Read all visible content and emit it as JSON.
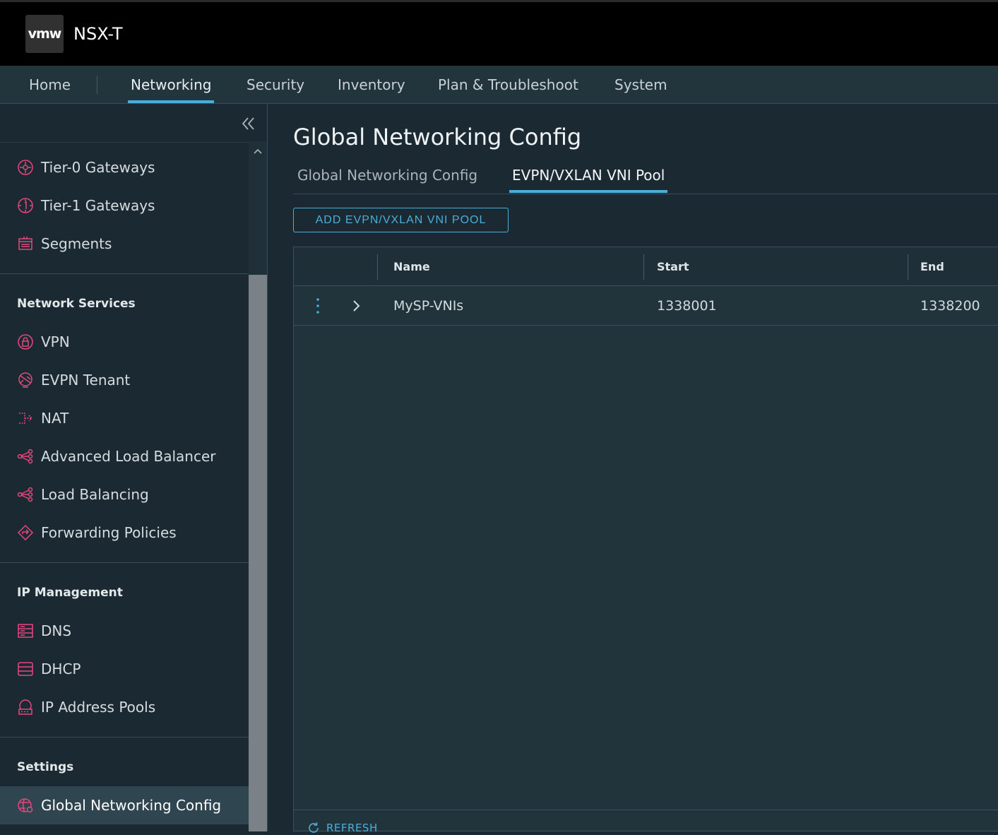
{
  "header": {
    "logo": "vmw",
    "app_title": "NSX-T"
  },
  "nav": {
    "items": [
      {
        "label": "Home"
      },
      {
        "label": "Networking"
      },
      {
        "label": "Security"
      },
      {
        "label": "Inventory"
      },
      {
        "label": "Plan & Troubleshoot"
      },
      {
        "label": "System"
      }
    ],
    "active": "Networking"
  },
  "sidebar": {
    "top_items": [
      {
        "label": "Tier-0 Gateways",
        "icon": "tier0-gateway-icon"
      },
      {
        "label": "Tier-1 Gateways",
        "icon": "tier1-gateway-icon"
      },
      {
        "label": "Segments",
        "icon": "segments-icon"
      }
    ],
    "network_services": {
      "title": "Network Services",
      "items": [
        {
          "label": "VPN",
          "icon": "vpn-icon"
        },
        {
          "label": "EVPN Tenant",
          "icon": "evpn-tenant-icon"
        },
        {
          "label": "NAT",
          "icon": "nat-icon"
        },
        {
          "label": "Advanced Load Balancer",
          "icon": "advanced-load-balancer-icon"
        },
        {
          "label": "Load Balancing",
          "icon": "load-balancing-icon"
        },
        {
          "label": "Forwarding Policies",
          "icon": "forwarding-policies-icon"
        }
      ]
    },
    "ip_management": {
      "title": "IP Management",
      "items": [
        {
          "label": "DNS",
          "icon": "dns-icon"
        },
        {
          "label": "DHCP",
          "icon": "dhcp-icon"
        },
        {
          "label": "IP Address Pools",
          "icon": "ip-address-pools-icon"
        }
      ]
    },
    "settings": {
      "title": "Settings",
      "items": [
        {
          "label": "Global Networking Config",
          "icon": "global-networking-config-icon"
        }
      ]
    },
    "active": "Global Networking Config"
  },
  "main": {
    "title": "Global Networking Config",
    "tabs": [
      {
        "label": "Global Networking Config"
      },
      {
        "label": "EVPN/VXLAN VNI Pool"
      }
    ],
    "active_tab": "EVPN/VXLAN VNI Pool",
    "add_button": "ADD EVPN/VXLAN VNI POOL",
    "grid": {
      "columns": [
        "Name",
        "Start",
        "End"
      ],
      "rows": [
        {
          "name": "MySP-VNIs",
          "start": "1338001",
          "end": "1338200"
        }
      ],
      "refresh_label": "REFRESH"
    }
  },
  "colors": {
    "accent": "#49afd9",
    "icon_pink": "#e4487c",
    "header_bg": "#000000",
    "nav_bg": "#22343c",
    "body_bg": "#1b2a32"
  }
}
